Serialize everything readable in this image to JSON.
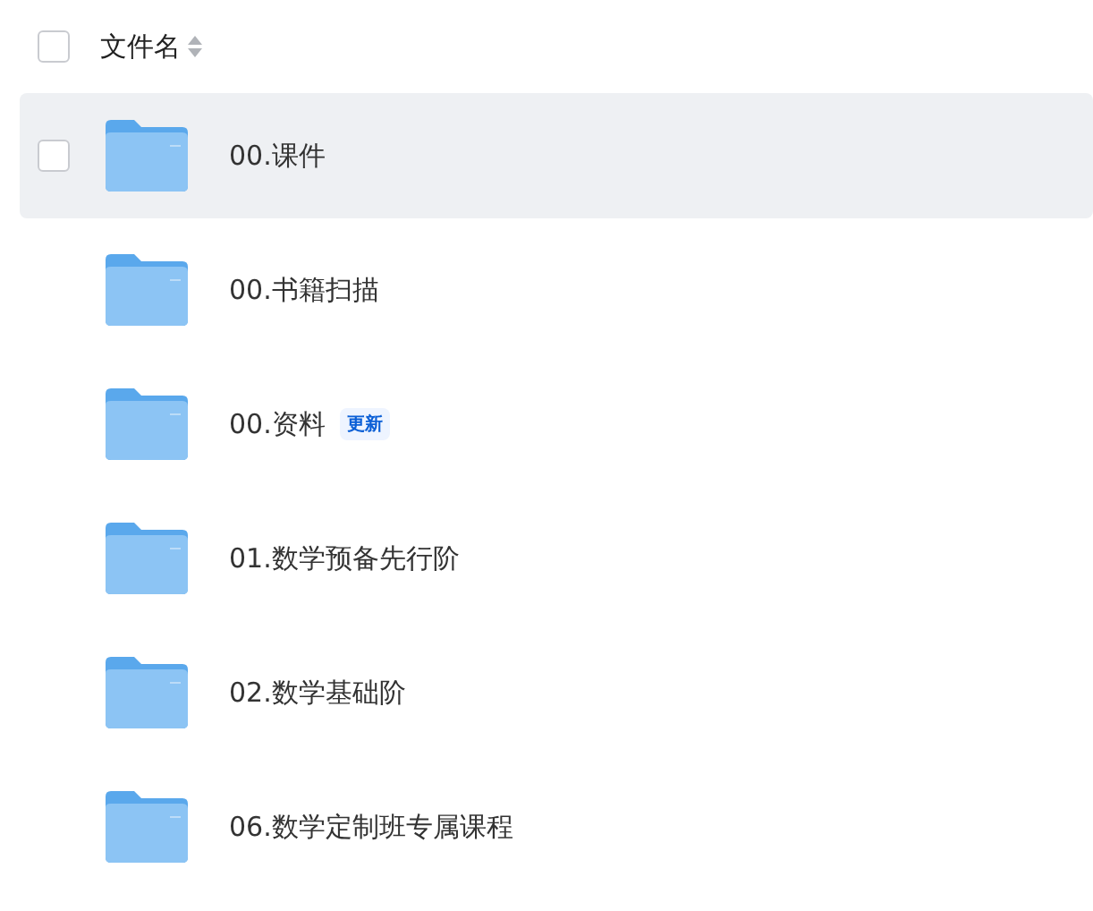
{
  "header": {
    "checked": false,
    "column": "文件名"
  },
  "rows": [
    {
      "name": "00.课件",
      "hovered": true,
      "checked": false
    },
    {
      "name": "00.书籍扫描",
      "hovered": false,
      "checked": false
    },
    {
      "name": "00.资料",
      "hovered": false,
      "checked": false,
      "badge": "更新"
    },
    {
      "name": "01.数学预备先行阶",
      "hovered": false,
      "checked": false
    },
    {
      "name": "02.数学基础阶",
      "hovered": false,
      "checked": false
    },
    {
      "name": "06.数学定制班专属课程",
      "hovered": false,
      "checked": false
    }
  ]
}
